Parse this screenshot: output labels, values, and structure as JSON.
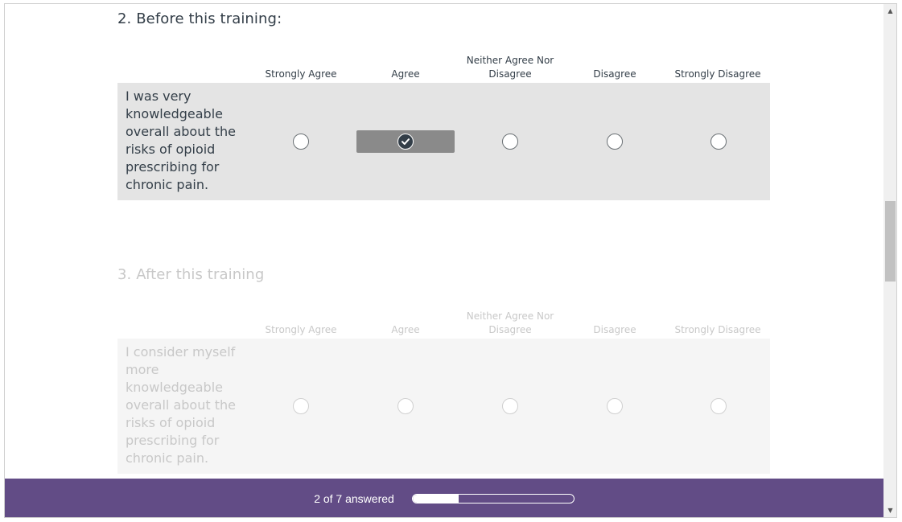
{
  "question2": {
    "title": "2. Before this training:",
    "columns": [
      "Strongly Agree",
      "Agree",
      "Neither Agree Nor Disagree",
      "Disagree",
      "Strongly Disagree"
    ],
    "row_label": "I was very knowledgeable overall about the risks of opioid prescribing for chronic pain.",
    "selected": "Agree"
  },
  "question3": {
    "title": "3. After this training",
    "columns": [
      "Strongly Agree",
      "Agree",
      "Neither Agree Nor Disagree",
      "Disagree",
      "Strongly Disagree"
    ],
    "row_label": "I consider myself more knowledgeable overall about the risks of opioid prescribing for chronic pain."
  },
  "footer": {
    "progress_text": "2 of 7 answered",
    "answered": 2,
    "total": 7
  },
  "scrollbar": {
    "up_icon": "▲",
    "down_icon": "▼"
  },
  "colors": {
    "footer_bg": "#624c86",
    "selected_bg": "#8a8a8a",
    "active_row_bg": "#e4e4e4"
  }
}
